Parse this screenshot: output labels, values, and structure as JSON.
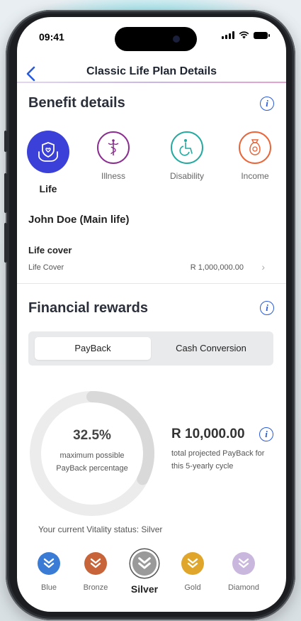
{
  "status_bar": {
    "time": "09:41"
  },
  "navbar": {
    "back_icon": "chevron-left-icon",
    "title": "Classic Life Plan Details"
  },
  "benefit_details": {
    "title": "Benefit details",
    "info_icon": "info-icon",
    "tabs": [
      {
        "label": "Life",
        "icon": "hand-shield-icon",
        "color": "#3b40d8",
        "active": true
      },
      {
        "label": "Illness",
        "icon": "caduceus-icon",
        "color": "#8a2f8f",
        "active": false
      },
      {
        "label": "Disability",
        "icon": "wheelchair-icon",
        "color": "#27a9a0",
        "active": false
      },
      {
        "label": "Income",
        "icon": "money-bag-icon",
        "color": "#e8663a",
        "active": false
      }
    ],
    "insured": "John Doe (Main life)",
    "life_cover_heading": "Life cover",
    "rows": [
      {
        "label": "Life Cover",
        "value": "R 1,000,000.00"
      }
    ]
  },
  "financial_rewards": {
    "title": "Financial rewards",
    "info_icon": "info-icon",
    "segments": [
      {
        "label": "PayBack",
        "active": true
      },
      {
        "label": "Cash Conversion",
        "active": false
      }
    ],
    "payback_percentage": "32.5%",
    "payback_percentage_value": 0.325,
    "payback_percentage_desc": "maximum possible PayBack percentage",
    "projected_amount": "R 10,000.00",
    "projected_desc": "total projected PayBack for this 5-yearly cycle",
    "vitality_status": "Your current Vitality status: Silver",
    "statuses": [
      {
        "label": "Blue",
        "color": "#3a7bd5",
        "active": false
      },
      {
        "label": "Bronze",
        "color": "#c8643a",
        "active": false
      },
      {
        "label": "Silver",
        "color": "#9a9a9a",
        "active": true
      },
      {
        "label": "Gold",
        "color": "#e0a62c",
        "active": false
      },
      {
        "label": "Diamond",
        "color": "#c9b7de",
        "active": false
      }
    ]
  }
}
